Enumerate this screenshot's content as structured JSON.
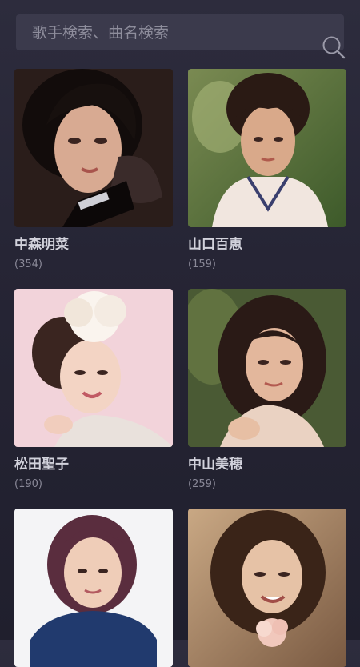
{
  "search": {
    "placeholder": "歌手検索、曲名検索",
    "icon": "search-icon"
  },
  "artists": [
    {
      "name": "中森明菜",
      "count": "(354)"
    },
    {
      "name": "山口百恵",
      "count": "(159)"
    },
    {
      "name": "松田聖子",
      "count": "(190)"
    },
    {
      "name": "中山美穂",
      "count": "(259)"
    },
    {
      "name": "",
      "count": ""
    },
    {
      "name": "",
      "count": ""
    }
  ],
  "colors": {
    "background": "#262535",
    "search_bg": "#3b3a4c",
    "name_text": "#d2d2dc",
    "count_text": "#8a8998"
  }
}
